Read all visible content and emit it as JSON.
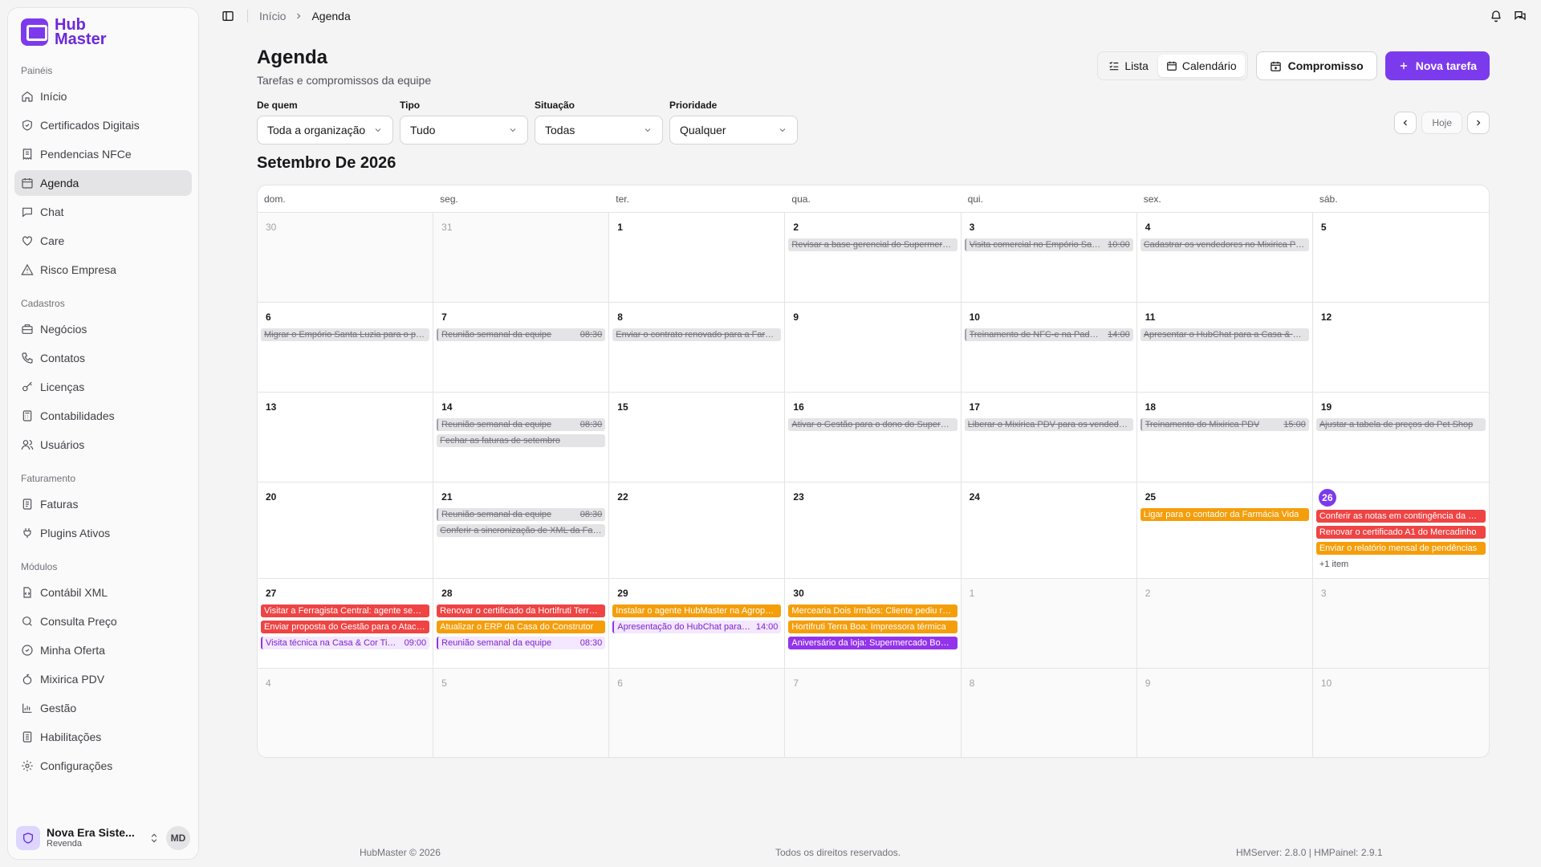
{
  "brand": {
    "line1": "Hub",
    "line2": "Master"
  },
  "sidebar": {
    "sections": [
      {
        "label": "Painéis",
        "items": [
          {
            "label": "Início",
            "icon": "home-icon"
          },
          {
            "label": "Certificados Digitais",
            "icon": "shield-icon"
          },
          {
            "label": "Pendencias NFCe",
            "icon": "receipt-icon"
          },
          {
            "label": "Agenda",
            "icon": "calendar-icon",
            "active": true
          },
          {
            "label": "Chat",
            "icon": "chat-icon"
          },
          {
            "label": "Care",
            "icon": "heart-icon"
          },
          {
            "label": "Risco Empresa",
            "icon": "warning-icon"
          }
        ]
      },
      {
        "label": "Cadastros",
        "items": [
          {
            "label": "Negócios",
            "icon": "briefcase-icon"
          },
          {
            "label": "Contatos",
            "icon": "phone-icon"
          },
          {
            "label": "Licenças",
            "icon": "key-icon"
          },
          {
            "label": "Contabilidades",
            "icon": "calculator-icon"
          },
          {
            "label": "Usuários",
            "icon": "users-icon"
          }
        ]
      },
      {
        "label": "Faturamento",
        "items": [
          {
            "label": "Faturas",
            "icon": "invoice-icon"
          },
          {
            "label": "Plugins Ativos",
            "icon": "plug-icon"
          }
        ]
      },
      {
        "label": "Módulos",
        "items": [
          {
            "label": "Contábil XML",
            "icon": "file-code-icon"
          },
          {
            "label": "Consulta Preço",
            "icon": "search-icon"
          },
          {
            "label": "Minha Oferta",
            "icon": "badge-icon"
          },
          {
            "label": "Mixirica PDV",
            "icon": "fruit-icon"
          },
          {
            "label": "Gestão",
            "icon": "chart-icon"
          },
          {
            "label": "Habilitações",
            "icon": "list-icon"
          },
          {
            "label": "Configurações",
            "icon": "gear-icon"
          }
        ]
      }
    ],
    "org": {
      "name": "Nova Era Siste...",
      "role": "Revenda"
    },
    "user_initials": "MD"
  },
  "breadcrumb": {
    "home": "Início",
    "current": "Agenda"
  },
  "header": {
    "title": "Agenda",
    "subtitle": "Tarefas e compromissos da equipe",
    "view_list": "Lista",
    "view_calendar": "Calendário",
    "appointment": "Compromisso",
    "new_task": "Nova tarefa"
  },
  "filters": [
    {
      "label": "De quem",
      "value": "Toda a organização"
    },
    {
      "label": "Tipo",
      "value": "Tudo"
    },
    {
      "label": "Situação",
      "value": "Todas"
    },
    {
      "label": "Prioridade",
      "value": "Qualquer"
    }
  ],
  "today_label": "Hoje",
  "month_title": "Setembro De 2026",
  "weekdays": [
    "dom.",
    "seg.",
    "ter.",
    "qua.",
    "qui.",
    "sex.",
    "sáb."
  ],
  "days": [
    {
      "n": "30",
      "out": true,
      "events": []
    },
    {
      "n": "31",
      "out": true,
      "events": []
    },
    {
      "n": "1",
      "events": []
    },
    {
      "n": "2",
      "events": [
        {
          "s": "done",
          "t": "Revisar a base gerencial do Supermercado"
        }
      ]
    },
    {
      "n": "3",
      "events": [
        {
          "s": "done bar",
          "t": "Visita comercial no Empório Santa Luzia",
          "tm": "10:00"
        }
      ]
    },
    {
      "n": "4",
      "events": [
        {
          "s": "done",
          "t": "Cadastrar os vendedores no Mixirica PDV"
        }
      ]
    },
    {
      "n": "5",
      "events": []
    },
    {
      "n": "6",
      "events": [
        {
          "s": "done",
          "t": "Migrar o Empório Santa Luzia para o plano"
        }
      ]
    },
    {
      "n": "7",
      "events": [
        {
          "s": "done bar",
          "t": "Reunião semanal da equipe",
          "tm": "08:30"
        }
      ]
    },
    {
      "n": "8",
      "events": [
        {
          "s": "done",
          "t": "Enviar o contrato renovado para a Farmácia"
        }
      ]
    },
    {
      "n": "9",
      "events": []
    },
    {
      "n": "10",
      "events": [
        {
          "s": "done bar",
          "t": "Treinamento de NFC-e na Padaria",
          "tm": "14:00"
        }
      ]
    },
    {
      "n": "11",
      "events": [
        {
          "s": "done",
          "t": "Apresentar o HubChat para a Casa & Cor"
        }
      ]
    },
    {
      "n": "12",
      "events": []
    },
    {
      "n": "13",
      "events": []
    },
    {
      "n": "14",
      "events": [
        {
          "s": "done bar",
          "t": "Reunião semanal da equipe",
          "tm": "08:30"
        },
        {
          "s": "done",
          "t": "Fechar as faturas de setembro"
        }
      ]
    },
    {
      "n": "15",
      "events": []
    },
    {
      "n": "16",
      "events": [
        {
          "s": "done",
          "t": "Ativar o Gestão para o dono do Supermercado"
        }
      ]
    },
    {
      "n": "17",
      "events": [
        {
          "s": "done",
          "t": "Liberar o Mixirica PDV para os vendedores"
        }
      ]
    },
    {
      "n": "18",
      "events": [
        {
          "s": "done bar",
          "t": "Treinamento do Mixirica PDV",
          "tm": "15:00"
        }
      ]
    },
    {
      "n": "19",
      "events": [
        {
          "s": "done",
          "t": "Ajustar a tabela de preços do Pet Shop"
        }
      ]
    },
    {
      "n": "20",
      "events": []
    },
    {
      "n": "21",
      "events": [
        {
          "s": "done bar",
          "t": "Reunião semanal da equipe",
          "tm": "08:30"
        },
        {
          "s": "done",
          "t": "Conferir a sincronização de XML da Farmácia"
        }
      ]
    },
    {
      "n": "22",
      "events": []
    },
    {
      "n": "23",
      "events": []
    },
    {
      "n": "24",
      "events": []
    },
    {
      "n": "25",
      "events": [
        {
          "s": "orange",
          "t": "Ligar para o contador da Farmácia Vida"
        }
      ]
    },
    {
      "n": "26",
      "today": true,
      "events": [
        {
          "s": "red",
          "t": "Conferir as notas em contingência da Padaria"
        },
        {
          "s": "red",
          "t": "Renovar o certificado A1 do Mercadinho"
        },
        {
          "s": "orange",
          "t": "Enviar o relatório mensal de pendências"
        }
      ],
      "more": "+1 item"
    },
    {
      "n": "27",
      "events": [
        {
          "s": "red",
          "t": "Visitar a Ferragista Central: agente sem sinal"
        },
        {
          "s": "red",
          "t": "Enviar proposta do Gestão para o Atacadão"
        },
        {
          "s": "meet",
          "t": "Visita técnica na Casa & Cor Tintas",
          "tm": "09:00"
        }
      ]
    },
    {
      "n": "28",
      "events": [
        {
          "s": "red",
          "t": "Renovar o certificado da Hortifruti Terra Boa"
        },
        {
          "s": "orange",
          "t": "Atualizar o ERP da Casa do Construtor"
        },
        {
          "s": "meet",
          "t": "Reunião semanal da equipe",
          "tm": "08:30"
        }
      ]
    },
    {
      "n": "29",
      "events": [
        {
          "s": "orange",
          "t": "Instalar o agente HubMaster na Agropecuária"
        },
        {
          "s": "meet",
          "t": "Apresentação do HubChat para loja",
          "tm": "14:00"
        }
      ]
    },
    {
      "n": "30",
      "events": [
        {
          "s": "orange",
          "t": "Mercearia Dois Irmãos: Cliente pediu retorno"
        },
        {
          "s": "orange",
          "t": "Hortifruti Terra Boa: Impressora térmica"
        },
        {
          "s": "purple",
          "t": "Aniversário da loja: Supermercado Bom Preço"
        }
      ]
    },
    {
      "n": "1",
      "out": true,
      "events": []
    },
    {
      "n": "2",
      "out": true,
      "events": []
    },
    {
      "n": "3",
      "out": true,
      "events": []
    },
    {
      "n": "4",
      "out": true,
      "events": []
    },
    {
      "n": "5",
      "out": true,
      "events": []
    },
    {
      "n": "6",
      "out": true,
      "events": []
    },
    {
      "n": "7",
      "out": true,
      "events": []
    },
    {
      "n": "8",
      "out": true,
      "events": []
    },
    {
      "n": "9",
      "out": true,
      "events": []
    },
    {
      "n": "10",
      "out": true,
      "events": []
    }
  ],
  "footer": {
    "left": "HubMaster © 2026",
    "center": "Todos os direitos reservados.",
    "right": "HMServer: 2.8.0 | HMPainel: 2.9.1"
  }
}
